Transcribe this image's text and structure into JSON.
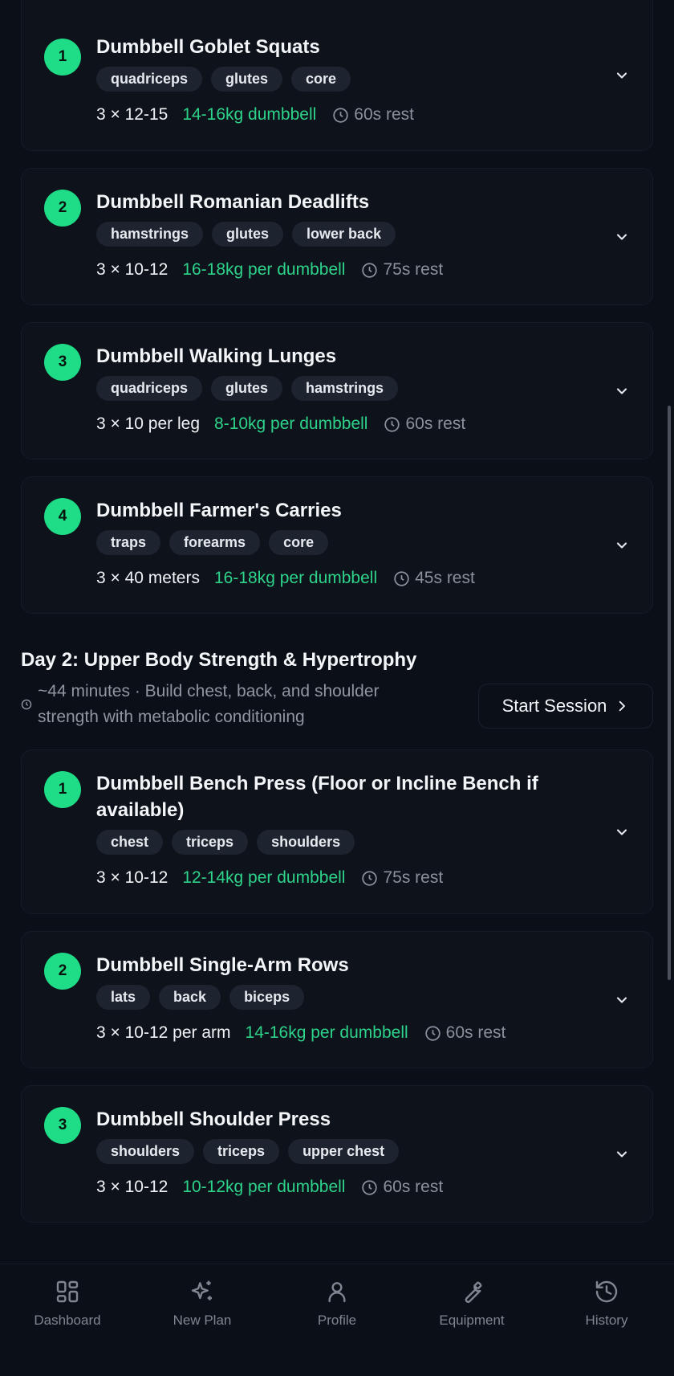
{
  "day1_exercises": [
    {
      "num": "1",
      "name": "Dumbbell Goblet Squats",
      "tags": [
        "quadriceps",
        "glutes",
        "core"
      ],
      "sets": "3 × 12-15",
      "weight": "14-16kg dumbbell",
      "rest": "60s rest"
    },
    {
      "num": "2",
      "name": "Dumbbell Romanian Deadlifts",
      "tags": [
        "hamstrings",
        "glutes",
        "lower back"
      ],
      "sets": "3 × 10-12",
      "weight": "16-18kg per dumbbell",
      "rest": "75s rest"
    },
    {
      "num": "3",
      "name": "Dumbbell Walking Lunges",
      "tags": [
        "quadriceps",
        "glutes",
        "hamstrings"
      ],
      "sets": "3 × 10 per leg",
      "weight": "8-10kg per dumbbell",
      "rest": "60s rest"
    },
    {
      "num": "4",
      "name": "Dumbbell Farmer's Carries",
      "tags": [
        "traps",
        "forearms",
        "core"
      ],
      "sets": "3 × 40 meters",
      "weight": "16-18kg per dumbbell",
      "rest": "45s rest"
    }
  ],
  "day2": {
    "title": "Day 2: Upper Body Strength & Hypertrophy",
    "desc": "~44 minutes · Build chest, back, and shoulder strength with metabolic conditioning",
    "start_label": "Start Session"
  },
  "day2_exercises": [
    {
      "num": "1",
      "name": "Dumbbell Bench Press (Floor or Incline Bench if available)",
      "tags": [
        "chest",
        "triceps",
        "shoulders"
      ],
      "sets": "3 × 10-12",
      "weight": "12-14kg per dumbbell",
      "rest": "75s rest"
    },
    {
      "num": "2",
      "name": "Dumbbell Single-Arm Rows",
      "tags": [
        "lats",
        "back",
        "biceps"
      ],
      "sets": "3 × 10-12 per arm",
      "weight": "14-16kg per dumbbell",
      "rest": "60s rest"
    },
    {
      "num": "3",
      "name": "Dumbbell Shoulder Press",
      "tags": [
        "shoulders",
        "triceps",
        "upper chest"
      ],
      "sets": "3 × 10-12",
      "weight": "10-12kg per dumbbell",
      "rest": "60s rest"
    }
  ],
  "nav": [
    {
      "label": "Dashboard",
      "icon": "dashboard-icon"
    },
    {
      "label": "New Plan",
      "icon": "sparkles-icon"
    },
    {
      "label": "Profile",
      "icon": "user-icon"
    },
    {
      "label": "Equipment",
      "icon": "wrench-icon"
    },
    {
      "label": "History",
      "icon": "history-icon"
    }
  ],
  "colors": {
    "accent": "#1fdc87",
    "weight_text": "#2ed38a",
    "background": "#0b0f17",
    "card": "#0d121b",
    "tag": "#1d2430"
  }
}
